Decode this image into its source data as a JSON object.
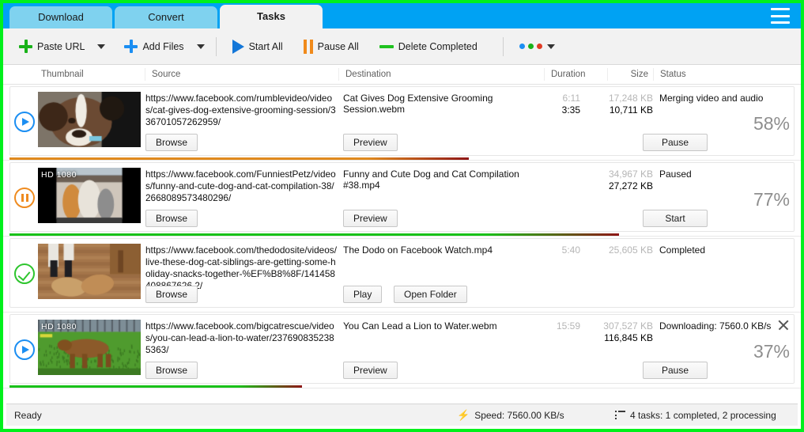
{
  "window": {
    "accent_blue": "#00a2f3",
    "border_green": "#00f01c"
  },
  "tabs": [
    {
      "label": "Download",
      "active": false
    },
    {
      "label": "Convert",
      "active": false
    },
    {
      "label": "Tasks",
      "active": true
    }
  ],
  "menu_button": "menu-icon",
  "toolbar": {
    "paste_url": "Paste URL",
    "add_files": "Add Files",
    "start_all": "Start All",
    "pause_all": "Pause All",
    "delete_completed": "Delete Completed",
    "more_dots": [
      "#1b8ef2",
      "#19b219",
      "#e03b24"
    ]
  },
  "columns": {
    "thumbnail": "Thumbnail",
    "source": "Source",
    "destination": "Destination",
    "duration": "Duration",
    "size": "Size",
    "status": "Status"
  },
  "tasks": [
    {
      "state_icon": "play-icon",
      "hd_badge": "",
      "source": "https://www.facebook.com/rumblevideo/videos/cat-gives-dog-extensive-grooming-session/336701057262959/",
      "destination": "Cat Gives Dog Extensive Grooming Session.webm",
      "duration_total": "6:11",
      "duration_done": "3:35",
      "size_total": "17,248 KB",
      "size_done": "10,711 KB",
      "status": "Merging video and audio",
      "percent": "58%",
      "progress": 58,
      "progress_color": "#e08a1e",
      "browse": "Browse",
      "action_a": "Preview",
      "action_b": "",
      "action_right": "Pause",
      "has_close": false
    },
    {
      "state_icon": "pause-icon",
      "hd_badge": "HD 1080",
      "source": "https://www.facebook.com/FunniestPetz/videos/funny-and-cute-dog-and-cat-compilation-38/2668089573480296/",
      "destination": "Funny and Cute Dog and Cat Compilation #38.mp4",
      "duration_total": "",
      "duration_done": "",
      "size_total": "34,967 KB",
      "size_done": "27,272 KB",
      "status": "Paused",
      "percent": "77%",
      "progress": 77,
      "progress_color": "#19c219",
      "browse": "Browse",
      "action_a": "Preview",
      "action_b": "",
      "action_right": "Start",
      "has_close": false
    },
    {
      "state_icon": "check-icon",
      "hd_badge": "",
      "source": "https://www.facebook.com/thedodosite/videos/live-these-dog-cat-siblings-are-getting-some-holiday-snacks-together-%EF%B8%8F/141458408867626 2/",
      "destination": "The Dodo on Facebook Watch.mp4",
      "duration_total": "5:40",
      "duration_done": "",
      "size_total": "25,605 KB",
      "size_done": "",
      "status": "Completed",
      "percent": "",
      "progress": 0,
      "progress_color": "",
      "browse": "Browse",
      "action_a": "Play",
      "action_b": "Open Folder",
      "action_right": "",
      "has_close": false
    },
    {
      "state_icon": "play-icon",
      "hd_badge": "HD 1080",
      "source": "https://www.facebook.com/bigcatrescue/videos/you-can-lead-a-lion-to-water/2376908352385363/",
      "destination": "You Can Lead a Lion to Water.webm",
      "duration_total": "15:59",
      "duration_done": "",
      "size_total": "307,527 KB",
      "size_done": "116,845 KB",
      "status": "Downloading: 7560.0 KB/s",
      "percent": "37%",
      "progress": 37,
      "progress_color": "#19c219",
      "browse": "Browse",
      "action_a": "Preview",
      "action_b": "",
      "action_right": "Pause",
      "has_close": true
    }
  ],
  "statusbar": {
    "ready": "Ready",
    "speed": "Speed: 7560.00 KB/s",
    "tasks": "4 tasks: 1 completed, 2 processing"
  }
}
